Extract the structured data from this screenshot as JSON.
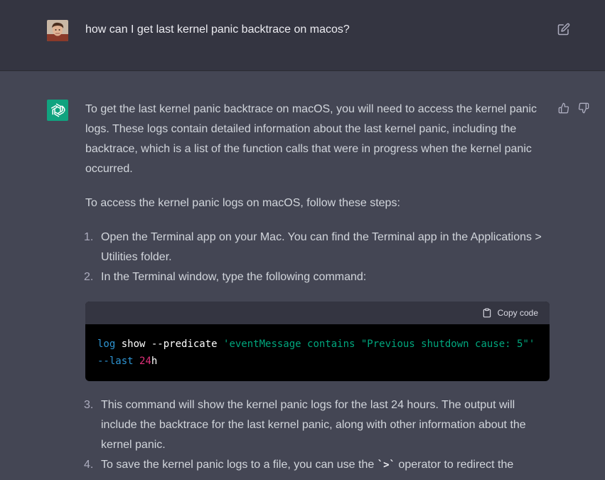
{
  "user_message": {
    "text": "how can I get last kernel panic backtrace on macos?",
    "avatar": "user-photo",
    "edit_icon": "edit-icon"
  },
  "assistant": {
    "avatar_icon": "openai-logo-icon",
    "paragraph1": "To get the last kernel panic backtrace on macOS, you will need to access the kernel panic logs. These logs contain detailed information about the last kernel panic, including the backtrace, which is a list of the function calls that were in progress when the kernel panic occurred.",
    "paragraph2": "To access the kernel panic logs on macOS, follow these steps:",
    "steps": [
      {
        "num": "1.",
        "text": "Open the Terminal app on your Mac. You can find the Terminal app in the Applications > Utilities folder."
      },
      {
        "num": "2.",
        "text": "In the Terminal window, type the following command:"
      },
      {
        "num": "3.",
        "text": "This command will show the kernel panic logs for the last 24 hours. The output will include the backtrace for the last kernel panic, along with other information about the kernel panic."
      },
      {
        "num": "4.",
        "text_before": "To save the kernel panic logs to a file, you can use the ",
        "inline_code": "`>`",
        "text_after": " operator to redirect the"
      }
    ],
    "code": {
      "copy_label": "Copy code",
      "tok1": "log",
      "tok2": " show --predicate ",
      "tok3": "'eventMessage contains \"Previous shutdown cause: 5\"'",
      "tok4": "--last",
      "tok5": " ",
      "tok6": "24",
      "tok7": "h"
    },
    "feedback": {
      "thumbs_up": "thumbs-up-icon",
      "thumbs_down": "thumbs-down-icon"
    }
  },
  "colors": {
    "user_bg": "#343541",
    "assistant_bg": "#444654",
    "accent": "#10a37f",
    "text": "#d1d5db"
  }
}
